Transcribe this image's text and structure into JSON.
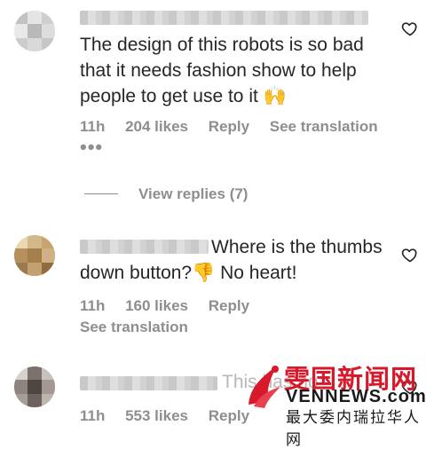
{
  "comments": [
    {
      "text": "The design of this robots is so bad that it needs fashion show to help people to get use to it 🙌",
      "time": "11h",
      "likes": "204 likes",
      "reply": "Reply",
      "translate": "See translation",
      "more": "•••"
    },
    {
      "text": "Where is the thumbs down button?👎 No heart!",
      "time": "11h",
      "likes": "160 likes",
      "reply": "Reply",
      "translate": "See translation"
    },
    {
      "text": "This has no",
      "time": "11h",
      "likes": "553 likes",
      "reply": "Reply"
    }
  ],
  "view_replies": "View replies (7)",
  "watermark": {
    "cn": "雯国新闻网",
    "en": "VENNEWS.com",
    "sub": "最大委内瑞拉华人网"
  },
  "icons": {
    "heart": "heart-outline-icon",
    "logo": "bird-logo-icon"
  },
  "colors": {
    "text": "#262626",
    "meta": "#8e8e8e",
    "brand_red": "#d8192b"
  }
}
